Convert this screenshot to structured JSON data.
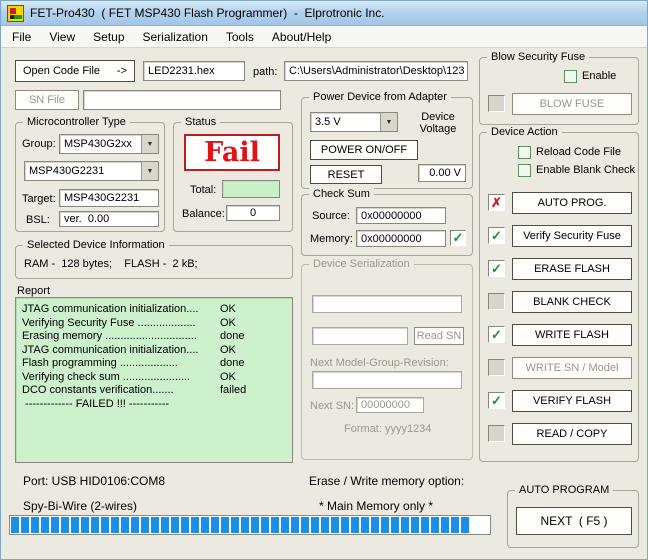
{
  "window": {
    "title": "FET-Pro430  ( FET MSP430 Flash Programmer)  -  Elprotronic Inc."
  },
  "menu": {
    "items": [
      "File",
      "View",
      "Setup",
      "Serialization",
      "Tools",
      "About/Help"
    ]
  },
  "icons": {
    "dropdown_arrow": "▼",
    "check": "✓",
    "cross": "✗",
    "arrow_right": "->"
  },
  "file_row": {
    "open_button": "Open Code File",
    "code_file": "LED2231.hex",
    "path_label": "path:",
    "path_value": "C:\\Users\\Administrator\\Desktop\\123",
    "sn_button": "SN File",
    "sn_value": ""
  },
  "micro": {
    "title": "Microcontroller Type",
    "group_label": "Group:",
    "group_value": "MSP430G2xx",
    "device_value": "MSP430G2231",
    "target_label": "Target:",
    "target_value": "MSP430G2231",
    "bsl_label": "BSL:",
    "bsl_value": "ver.  0.00"
  },
  "status": {
    "title": "Status",
    "result": "Fail",
    "total_label": "Total:",
    "total_value": "",
    "balance_label": "Balance:",
    "balance_value": "0"
  },
  "device_info": {
    "title": "Selected Device Information",
    "text": "RAM -  128 bytes;    FLASH -  2 kB;"
  },
  "report": {
    "title": "Report",
    "lines": [
      {
        "label": "JTAG communication initialization....",
        "status": "OK"
      },
      {
        "label": "Verifying Security Fuse ...................",
        "status": "OK"
      },
      {
        "label": "Erasing memory ..............................",
        "status": "done"
      },
      {
        "label": "JTAG communication initialization....",
        "status": "OK"
      },
      {
        "label": "Flash programming ...................",
        "status": "done"
      },
      {
        "label": "Verifying check sum ......................",
        "status": "OK"
      },
      {
        "label": "DCO constants verification.......",
        "status": "failed"
      },
      {
        "label": " ------------- FAILED !!! -----------",
        "status": ""
      }
    ]
  },
  "power": {
    "title": "Power Device from Adapter",
    "adapter_voltage": "3.5 V",
    "device_voltage_label": "Device Voltage",
    "power_button": "POWER ON/OFF",
    "reset_button": "RESET",
    "voltage_reading": "0.00 V"
  },
  "checksum": {
    "title": "Check Sum",
    "source_label": "Source:",
    "source_value": "0x00000000",
    "memory_label": "Memory:",
    "memory_value": "0x00000000"
  },
  "serialization": {
    "title": "Device Serialization",
    "field1": "",
    "field2": "",
    "read_sn_button": "Read SN",
    "next_model_label": "Next Model-Group-Revision:",
    "field3": "",
    "next_sn_label": "Next SN:",
    "next_sn_value": "00000000",
    "format_label": "Format: yyyy1234"
  },
  "blow_fuse": {
    "title": "Blow Security Fuse",
    "enable_label": "Enable",
    "blow_button": "BLOW FUSE"
  },
  "device_action": {
    "title": "Device Action",
    "reload_label": "Reload Code File",
    "blank_check_label": "Enable Blank Check",
    "buttons": [
      {
        "label": "AUTO PROG."
      },
      {
        "label": "Verify Security Fuse"
      },
      {
        "label": "ERASE FLASH"
      },
      {
        "label": "BLANK CHECK"
      },
      {
        "label": "WRITE FLASH"
      },
      {
        "label": "WRITE SN / Model"
      },
      {
        "label": "VERIFY FLASH"
      },
      {
        "label": "READ / COPY"
      }
    ]
  },
  "footer": {
    "port": "Port: USB HID0106:COM8",
    "wire": "Spy-Bi-Wire (2-wires)",
    "erase_option_label": "Erase / Write memory option:",
    "erase_option_value": "* Main Memory only *"
  },
  "auto_program": {
    "title": "AUTO PROGRAM",
    "next_button": "NEXT  ( F5 )"
  },
  "progress": {
    "percent_full": 96
  }
}
